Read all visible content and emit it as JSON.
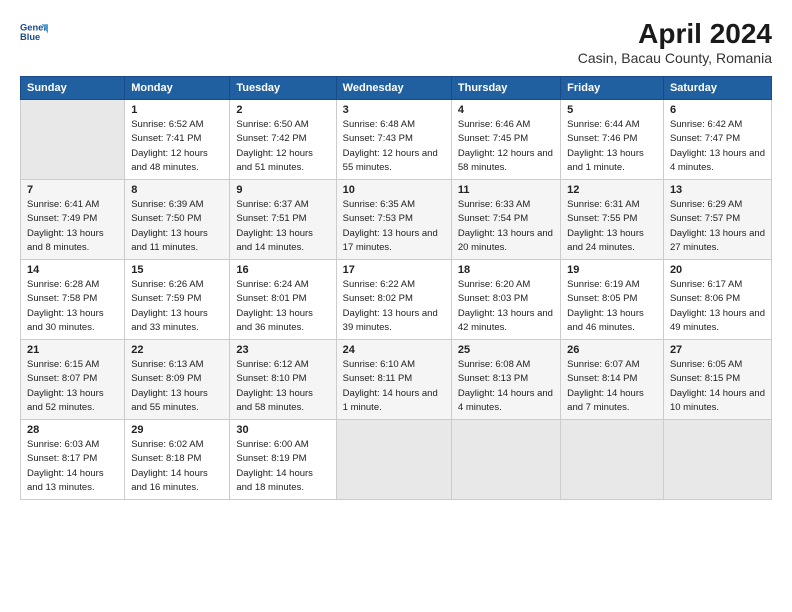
{
  "header": {
    "title": "April 2024",
    "subtitle": "Casin, Bacau County, Romania"
  },
  "columns": [
    "Sunday",
    "Monday",
    "Tuesday",
    "Wednesday",
    "Thursday",
    "Friday",
    "Saturday"
  ],
  "weeks": [
    [
      {
        "day": "",
        "sunrise": "",
        "sunset": "",
        "daylight": "",
        "empty": true
      },
      {
        "day": "1",
        "sunrise": "Sunrise: 6:52 AM",
        "sunset": "Sunset: 7:41 PM",
        "daylight": "Daylight: 12 hours and 48 minutes."
      },
      {
        "day": "2",
        "sunrise": "Sunrise: 6:50 AM",
        "sunset": "Sunset: 7:42 PM",
        "daylight": "Daylight: 12 hours and 51 minutes."
      },
      {
        "day": "3",
        "sunrise": "Sunrise: 6:48 AM",
        "sunset": "Sunset: 7:43 PM",
        "daylight": "Daylight: 12 hours and 55 minutes."
      },
      {
        "day": "4",
        "sunrise": "Sunrise: 6:46 AM",
        "sunset": "Sunset: 7:45 PM",
        "daylight": "Daylight: 12 hours and 58 minutes."
      },
      {
        "day": "5",
        "sunrise": "Sunrise: 6:44 AM",
        "sunset": "Sunset: 7:46 PM",
        "daylight": "Daylight: 13 hours and 1 minute."
      },
      {
        "day": "6",
        "sunrise": "Sunrise: 6:42 AM",
        "sunset": "Sunset: 7:47 PM",
        "daylight": "Daylight: 13 hours and 4 minutes."
      }
    ],
    [
      {
        "day": "7",
        "sunrise": "Sunrise: 6:41 AM",
        "sunset": "Sunset: 7:49 PM",
        "daylight": "Daylight: 13 hours and 8 minutes."
      },
      {
        "day": "8",
        "sunrise": "Sunrise: 6:39 AM",
        "sunset": "Sunset: 7:50 PM",
        "daylight": "Daylight: 13 hours and 11 minutes."
      },
      {
        "day": "9",
        "sunrise": "Sunrise: 6:37 AM",
        "sunset": "Sunset: 7:51 PM",
        "daylight": "Daylight: 13 hours and 14 minutes."
      },
      {
        "day": "10",
        "sunrise": "Sunrise: 6:35 AM",
        "sunset": "Sunset: 7:53 PM",
        "daylight": "Daylight: 13 hours and 17 minutes."
      },
      {
        "day": "11",
        "sunrise": "Sunrise: 6:33 AM",
        "sunset": "Sunset: 7:54 PM",
        "daylight": "Daylight: 13 hours and 20 minutes."
      },
      {
        "day": "12",
        "sunrise": "Sunrise: 6:31 AM",
        "sunset": "Sunset: 7:55 PM",
        "daylight": "Daylight: 13 hours and 24 minutes."
      },
      {
        "day": "13",
        "sunrise": "Sunrise: 6:29 AM",
        "sunset": "Sunset: 7:57 PM",
        "daylight": "Daylight: 13 hours and 27 minutes."
      }
    ],
    [
      {
        "day": "14",
        "sunrise": "Sunrise: 6:28 AM",
        "sunset": "Sunset: 7:58 PM",
        "daylight": "Daylight: 13 hours and 30 minutes."
      },
      {
        "day": "15",
        "sunrise": "Sunrise: 6:26 AM",
        "sunset": "Sunset: 7:59 PM",
        "daylight": "Daylight: 13 hours and 33 minutes."
      },
      {
        "day": "16",
        "sunrise": "Sunrise: 6:24 AM",
        "sunset": "Sunset: 8:01 PM",
        "daylight": "Daylight: 13 hours and 36 minutes."
      },
      {
        "day": "17",
        "sunrise": "Sunrise: 6:22 AM",
        "sunset": "Sunset: 8:02 PM",
        "daylight": "Daylight: 13 hours and 39 minutes."
      },
      {
        "day": "18",
        "sunrise": "Sunrise: 6:20 AM",
        "sunset": "Sunset: 8:03 PM",
        "daylight": "Daylight: 13 hours and 42 minutes."
      },
      {
        "day": "19",
        "sunrise": "Sunrise: 6:19 AM",
        "sunset": "Sunset: 8:05 PM",
        "daylight": "Daylight: 13 hours and 46 minutes."
      },
      {
        "day": "20",
        "sunrise": "Sunrise: 6:17 AM",
        "sunset": "Sunset: 8:06 PM",
        "daylight": "Daylight: 13 hours and 49 minutes."
      }
    ],
    [
      {
        "day": "21",
        "sunrise": "Sunrise: 6:15 AM",
        "sunset": "Sunset: 8:07 PM",
        "daylight": "Daylight: 13 hours and 52 minutes."
      },
      {
        "day": "22",
        "sunrise": "Sunrise: 6:13 AM",
        "sunset": "Sunset: 8:09 PM",
        "daylight": "Daylight: 13 hours and 55 minutes."
      },
      {
        "day": "23",
        "sunrise": "Sunrise: 6:12 AM",
        "sunset": "Sunset: 8:10 PM",
        "daylight": "Daylight: 13 hours and 58 minutes."
      },
      {
        "day": "24",
        "sunrise": "Sunrise: 6:10 AM",
        "sunset": "Sunset: 8:11 PM",
        "daylight": "Daylight: 14 hours and 1 minute."
      },
      {
        "day": "25",
        "sunrise": "Sunrise: 6:08 AM",
        "sunset": "Sunset: 8:13 PM",
        "daylight": "Daylight: 14 hours and 4 minutes."
      },
      {
        "day": "26",
        "sunrise": "Sunrise: 6:07 AM",
        "sunset": "Sunset: 8:14 PM",
        "daylight": "Daylight: 14 hours and 7 minutes."
      },
      {
        "day": "27",
        "sunrise": "Sunrise: 6:05 AM",
        "sunset": "Sunset: 8:15 PM",
        "daylight": "Daylight: 14 hours and 10 minutes."
      }
    ],
    [
      {
        "day": "28",
        "sunrise": "Sunrise: 6:03 AM",
        "sunset": "Sunset: 8:17 PM",
        "daylight": "Daylight: 14 hours and 13 minutes."
      },
      {
        "day": "29",
        "sunrise": "Sunrise: 6:02 AM",
        "sunset": "Sunset: 8:18 PM",
        "daylight": "Daylight: 14 hours and 16 minutes."
      },
      {
        "day": "30",
        "sunrise": "Sunrise: 6:00 AM",
        "sunset": "Sunset: 8:19 PM",
        "daylight": "Daylight: 14 hours and 18 minutes."
      },
      {
        "day": "",
        "sunrise": "",
        "sunset": "",
        "daylight": "",
        "empty": true
      },
      {
        "day": "",
        "sunrise": "",
        "sunset": "",
        "daylight": "",
        "empty": true
      },
      {
        "day": "",
        "sunrise": "",
        "sunset": "",
        "daylight": "",
        "empty": true
      },
      {
        "day": "",
        "sunrise": "",
        "sunset": "",
        "daylight": "",
        "empty": true
      }
    ]
  ]
}
